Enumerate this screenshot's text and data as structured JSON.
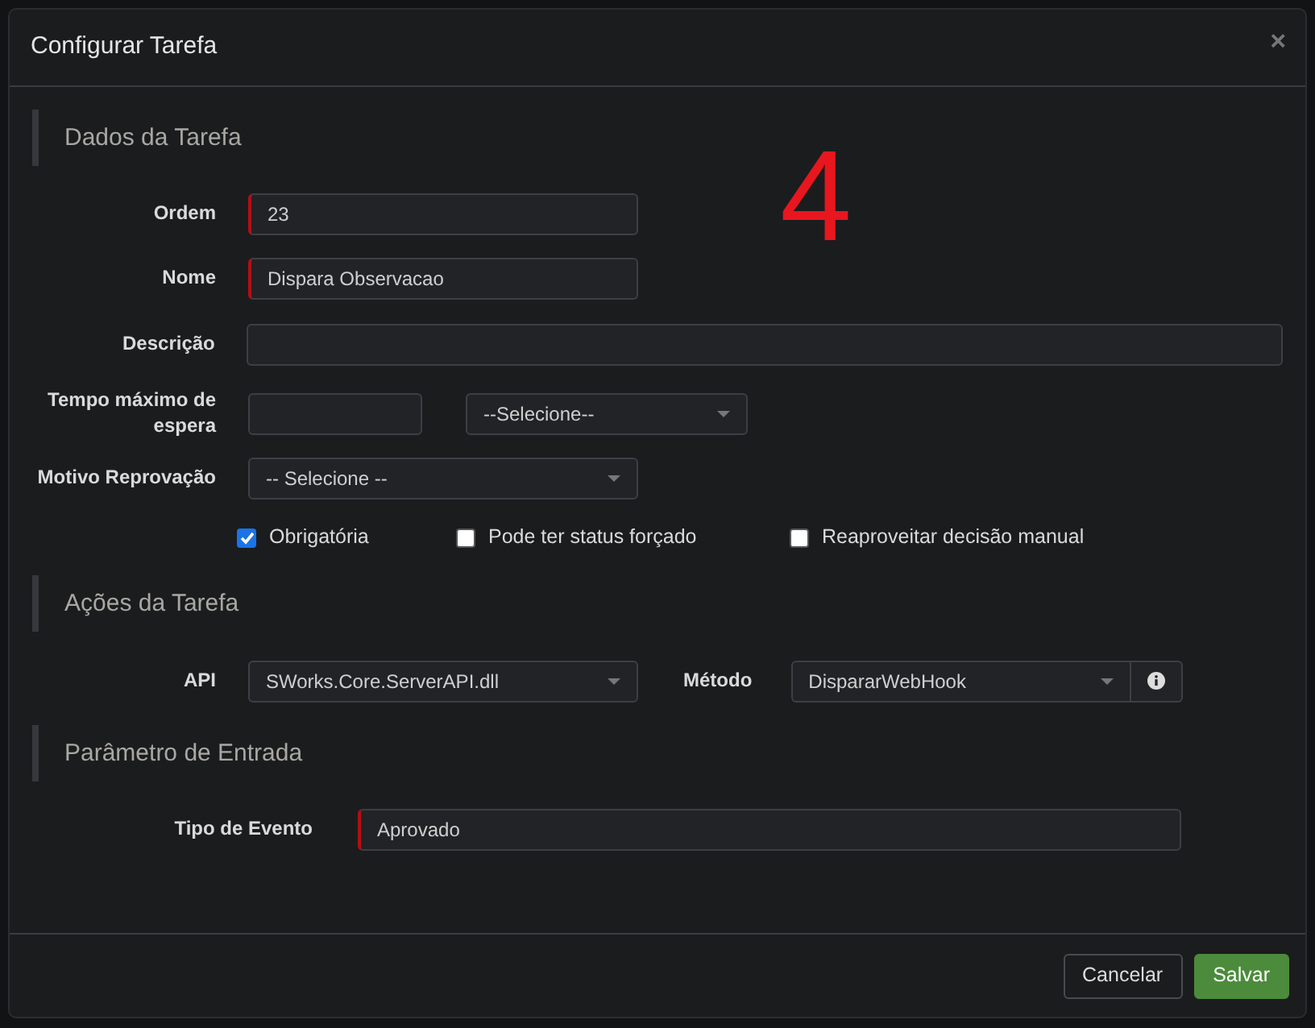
{
  "dialog": {
    "title": "Configurar Tarefa",
    "close_symbol": "×"
  },
  "annotation": {
    "text": "4"
  },
  "task_data": {
    "heading": "Dados da Tarefa",
    "fields": [
      {
        "label": "Ordem",
        "kind": "input",
        "value": "23",
        "required": true
      },
      {
        "label": "Nome",
        "kind": "input",
        "value": "Dispara Observacao",
        "required": true
      },
      {
        "label": "Descrição",
        "kind": "wide-input",
        "required": false
      },
      {
        "label": "Tempo máximo de espera",
        "kind": "input-select",
        "select_value": "--Selecione--",
        "required": false
      },
      {
        "label": "Motivo Reprovação",
        "kind": "select",
        "value": "-- Selecione --",
        "required": false
      }
    ],
    "options": [
      {
        "label": "Obrigatória",
        "checked": true
      },
      {
        "label": "Pode ter status forçado",
        "checked": false
      },
      {
        "label": "Reaproveitar decisão manual",
        "checked": false
      }
    ]
  },
  "task_actions": {
    "heading": "Ações da Tarefa",
    "api": {
      "label": "API",
      "value": "SWorks.Core.ServerAPI.dll"
    },
    "method": {
      "label": "Método",
      "value": "DispararWebHook"
    }
  },
  "input_parameters": {
    "heading": "Parâmetro de Entrada",
    "fields": [
      {
        "label": "Tipo de Evento",
        "value": "Aprovado",
        "required": true
      }
    ]
  },
  "buttons": [
    {
      "label": "Cancelar",
      "kind": "secondary"
    },
    {
      "label": "Salvar",
      "kind": "primary"
    }
  ]
}
